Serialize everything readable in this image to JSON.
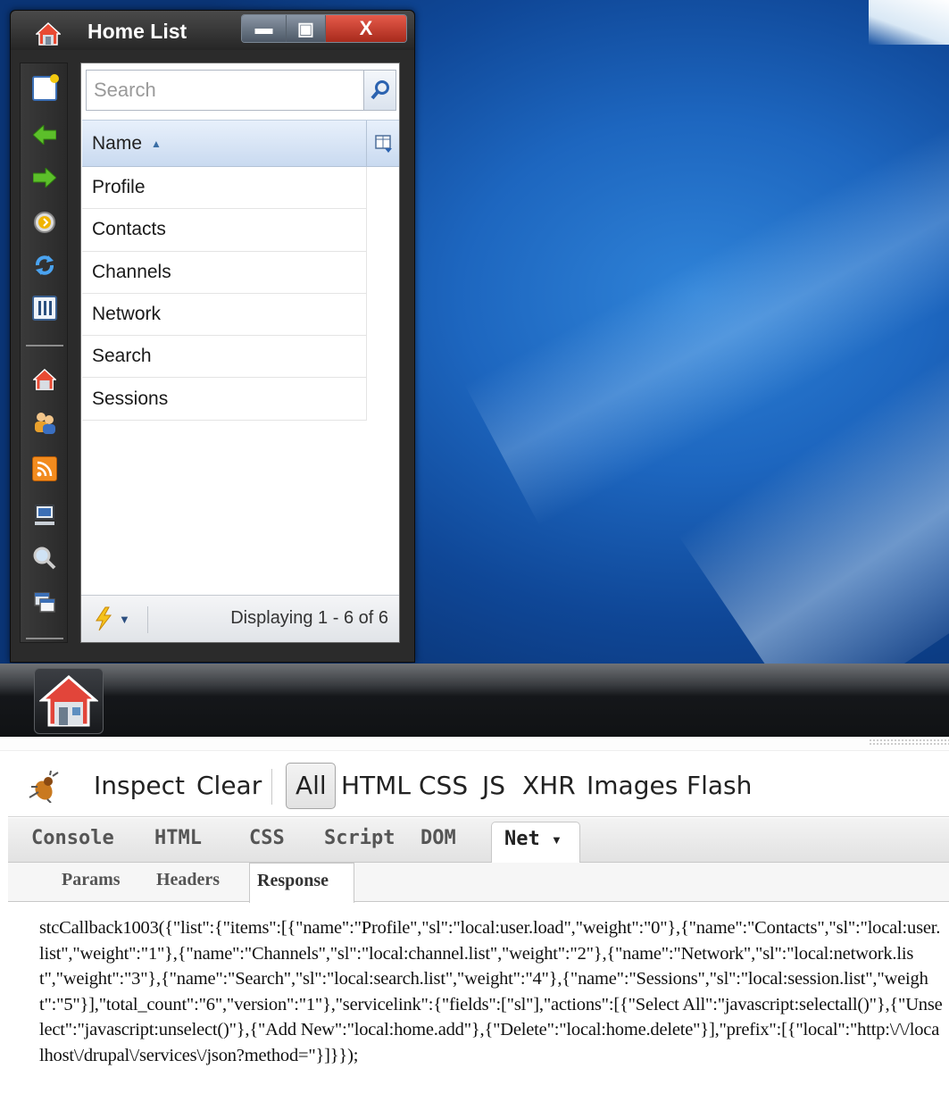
{
  "window": {
    "title": "Home List",
    "controls": {
      "minimize": "▬",
      "maximize": "▣",
      "close": "X"
    }
  },
  "side_toolbar": [
    {
      "icon": "note-icon"
    },
    {
      "icon": "back-arrow-icon"
    },
    {
      "icon": "forward-arrow-icon"
    },
    {
      "icon": "clock-icon"
    },
    {
      "icon": "refresh-icon"
    },
    {
      "icon": "columns-icon"
    },
    {
      "icon": "home-icon"
    },
    {
      "icon": "users-icon"
    },
    {
      "icon": "rss-icon"
    },
    {
      "icon": "computer-icon"
    },
    {
      "icon": "magnifier-icon"
    },
    {
      "icon": "windows-icon"
    }
  ],
  "search": {
    "placeholder": "Search"
  },
  "grid": {
    "column_name": "Name",
    "rows": [
      "Profile",
      "Contacts",
      "Channels",
      "Network",
      "Search",
      "Sessions"
    ]
  },
  "footer": {
    "status": "Displaying 1 - 6 of 6"
  },
  "firebug": {
    "tools": [
      "Inspect",
      "Clear",
      "All",
      "HTML",
      "CSS",
      "JS",
      "XHR",
      "Images",
      "Flash"
    ],
    "panels": [
      "Console",
      "HTML",
      "CSS",
      "Script",
      "DOM",
      "Net"
    ],
    "subtabs": [
      "Params",
      "Headers",
      "Response"
    ],
    "response_text": "stcCallback1003({\"list\":{\"items\":[{\"name\":\"Profile\",\"sl\":\"local:user.load\",\"weight\":\"0\"},{\"name\":\"Contacts\",\"sl\":\"local:user.list\",\"weight\":\"1\"},{\"name\":\"Channels\",\"sl\":\"local:channel.list\",\"weight\":\"2\"},{\"name\":\"Network\",\"sl\":\"local:network.list\",\"weight\":\"3\"},{\"name\":\"Search\",\"sl\":\"local:search.list\",\"weight\":\"4\"},{\"name\":\"Sessions\",\"sl\":\"local:session.list\",\"weight\":\"5\"}],\"total_count\":\"6\",\"version\":\"1\"},\"servicelink\":{\"fields\":[\"sl\"],\"actions\":[{\"Select All\":\"javascript:selectall()\"},{\"Unselect\":\"javascript:unselect()\"},{\"Add New\":\"local:home.add\"},{\"Delete\":\"local:home.delete\"}],\"prefix\":[{\"local\":\"http:\\/\\/localhost\\/drupal\\/services\\/json?method=\"}]}});"
  },
  "colors": {
    "desktop_blue": "#1d66bf",
    "window_chrome": "#2b2b2b",
    "grid_header": "#c9daf0",
    "close_red": "#c0392b"
  }
}
